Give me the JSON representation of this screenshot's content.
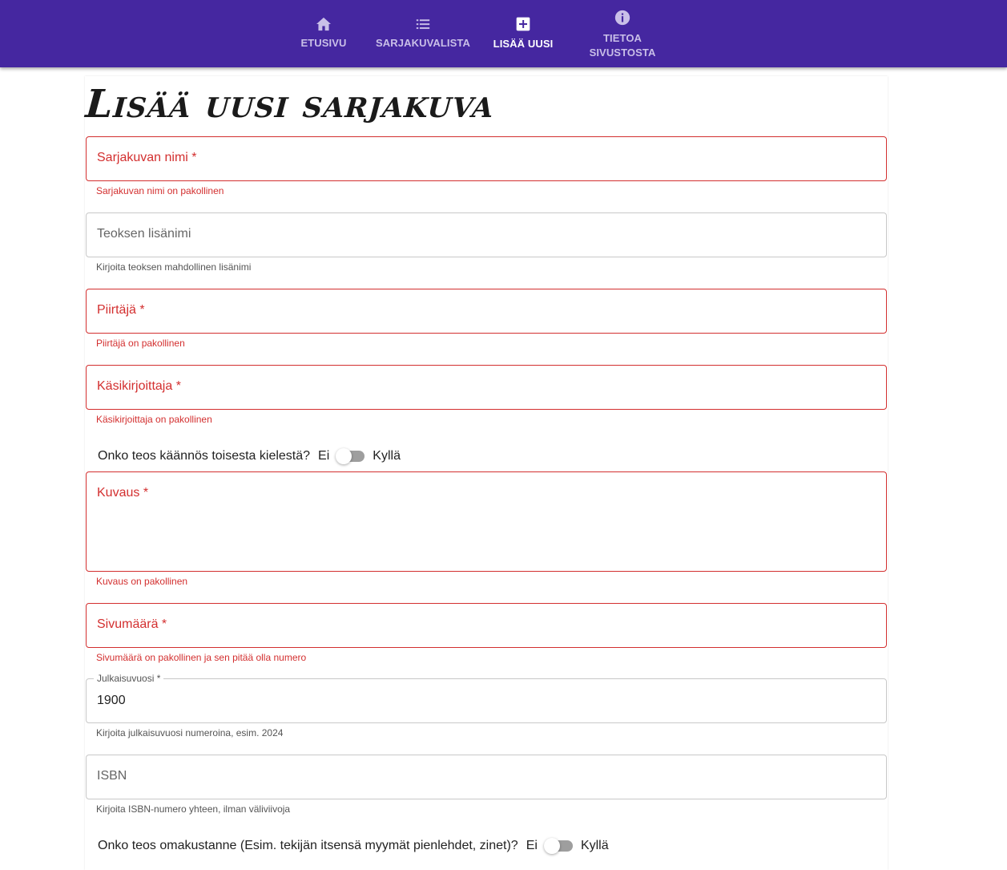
{
  "nav": {
    "items": [
      {
        "label": "ETUSIVU",
        "icon": "home-icon",
        "active": false
      },
      {
        "label": "SARJAKUVALISTA",
        "icon": "list-icon",
        "active": false
      },
      {
        "label": "LISÄÄ UUSI",
        "icon": "add-box-icon",
        "active": true
      },
      {
        "label": "TIETOA\nSIVUSTOSTA",
        "icon": "info-icon",
        "active": false
      }
    ],
    "colors": {
      "background": "#4527a0",
      "active": "#ffffff",
      "inactive": "#c9bfe8"
    }
  },
  "page": {
    "title": "Lisää uusi sarjakuva"
  },
  "form": {
    "title_field": {
      "label": "Sarjakuvan nimi *",
      "helper": "Sarjakuvan nimi on pakollinen",
      "value": ""
    },
    "subtitle_field": {
      "label": "Teoksen lisänimi",
      "helper": "Kirjoita teoksen mahdollinen lisänimi",
      "value": ""
    },
    "illustrator_field": {
      "label": "Piirtäjä *",
      "helper": "Piirtäjä on pakollinen",
      "value": ""
    },
    "writer_field": {
      "label": "Käsikirjoittaja *",
      "helper": "Käsikirjoittaja on pakollinen",
      "value": ""
    },
    "translation_switch": {
      "question": "Onko teos käännös toisesta kielestä?",
      "off_label": "Ei",
      "on_label": "Kyllä",
      "checked": false
    },
    "description_field": {
      "label": "Kuvaus *",
      "helper": "Kuvaus on pakollinen",
      "value": ""
    },
    "pages_field": {
      "label": "Sivumäärä *",
      "helper": "Sivumäärä on pakollinen ja sen pitää olla numero",
      "value": ""
    },
    "year_field": {
      "label": "Julkaisuvuosi *",
      "helper": "Kirjoita julkaisuvuosi numeroina, esim. 2024",
      "value": "1900"
    },
    "isbn_field": {
      "label": "ISBN",
      "helper": "Kirjoita ISBN-numero yhteen, ilman väliviivoja",
      "value": ""
    },
    "self_published_switch": {
      "question": "Onko teos omakustanne (Esim. tekijän itsensä myymät pienlehdet, zinet)?",
      "off_label": "Ei",
      "on_label": "Kyllä",
      "checked": false
    }
  },
  "colors": {
    "error": "#d32f2f",
    "border": "#c8c8c8"
  }
}
